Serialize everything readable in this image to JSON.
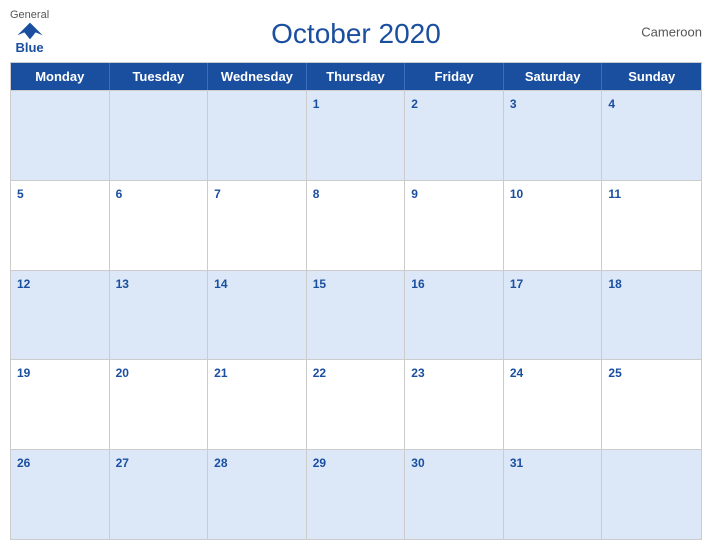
{
  "header": {
    "title": "October 2020",
    "country": "Cameroon",
    "logo": {
      "general": "General",
      "blue": "Blue"
    }
  },
  "days": {
    "headers": [
      "Monday",
      "Tuesday",
      "Wednesday",
      "Thursday",
      "Friday",
      "Saturday",
      "Sunday"
    ]
  },
  "weeks": [
    [
      null,
      null,
      null,
      "1",
      "2",
      "3",
      "4"
    ],
    [
      "5",
      "6",
      "7",
      "8",
      "9",
      "10",
      "11"
    ],
    [
      "12",
      "13",
      "14",
      "15",
      "16",
      "17",
      "18"
    ],
    [
      "19",
      "20",
      "21",
      "22",
      "23",
      "24",
      "25"
    ],
    [
      "26",
      "27",
      "28",
      "29",
      "30",
      "31",
      null
    ]
  ]
}
